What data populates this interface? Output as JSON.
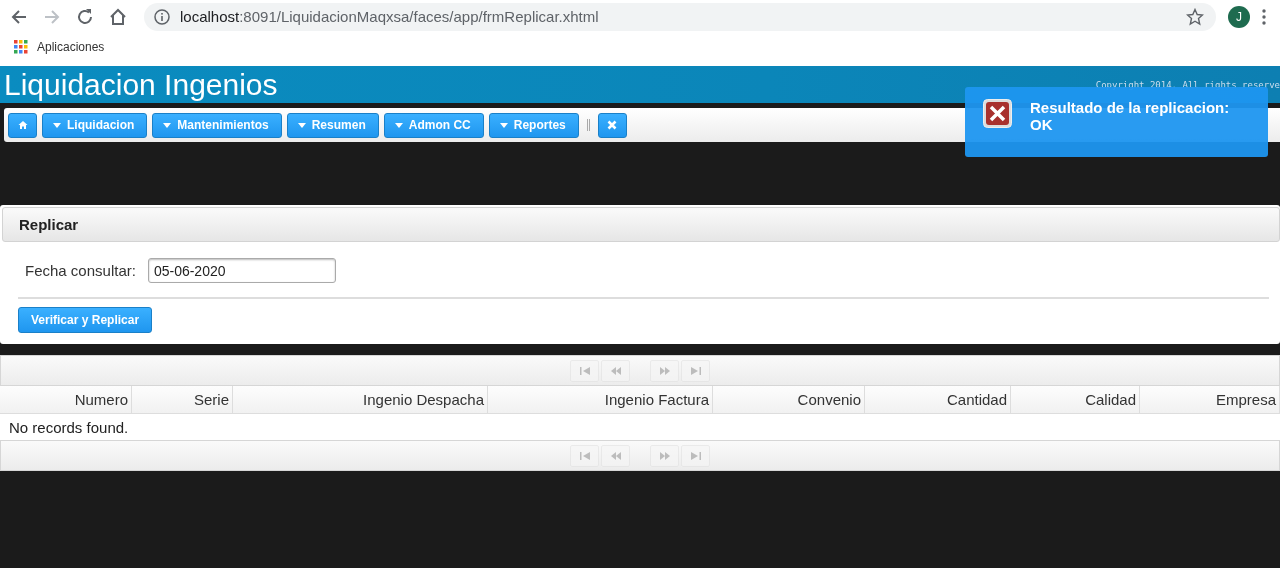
{
  "browser": {
    "url_host": "localhost",
    "url_path": ":8091/LiquidacionMaqxsa/faces/app/frmReplicar.xhtml",
    "profile_initial": "J",
    "bookmarks": [
      "Aplicaciones"
    ]
  },
  "header": {
    "title": "Liquidacion Ingenios",
    "copyright": "Copyright 2014. All rights reserve"
  },
  "toolbar": {
    "items": [
      {
        "kind": "home"
      },
      {
        "kind": "menu",
        "label": "Liquidacion"
      },
      {
        "kind": "menu",
        "label": "Mantenimientos"
      },
      {
        "kind": "menu",
        "label": "Resumen"
      },
      {
        "kind": "menu",
        "label": "Admon CC"
      },
      {
        "kind": "menu",
        "label": "Reportes"
      },
      {
        "kind": "separator"
      },
      {
        "kind": "close"
      }
    ]
  },
  "toast": {
    "title": "Resultado de la replicacion:",
    "detail": "OK"
  },
  "panel": {
    "title": "Replicar",
    "field_label": "Fecha consultar:",
    "field_value": "05-06-2020",
    "button": "Verificar y Replicar"
  },
  "table": {
    "columns": [
      "Numero",
      "Serie",
      "Ingenio Despacha",
      "Ingenio Factura",
      "Convenio",
      "Cantidad",
      "Calidad",
      "Empresa"
    ],
    "empty_message": "No records found.",
    "paginators": [
      {
        "disabled": true
      },
      {
        "disabled": true
      }
    ]
  }
}
